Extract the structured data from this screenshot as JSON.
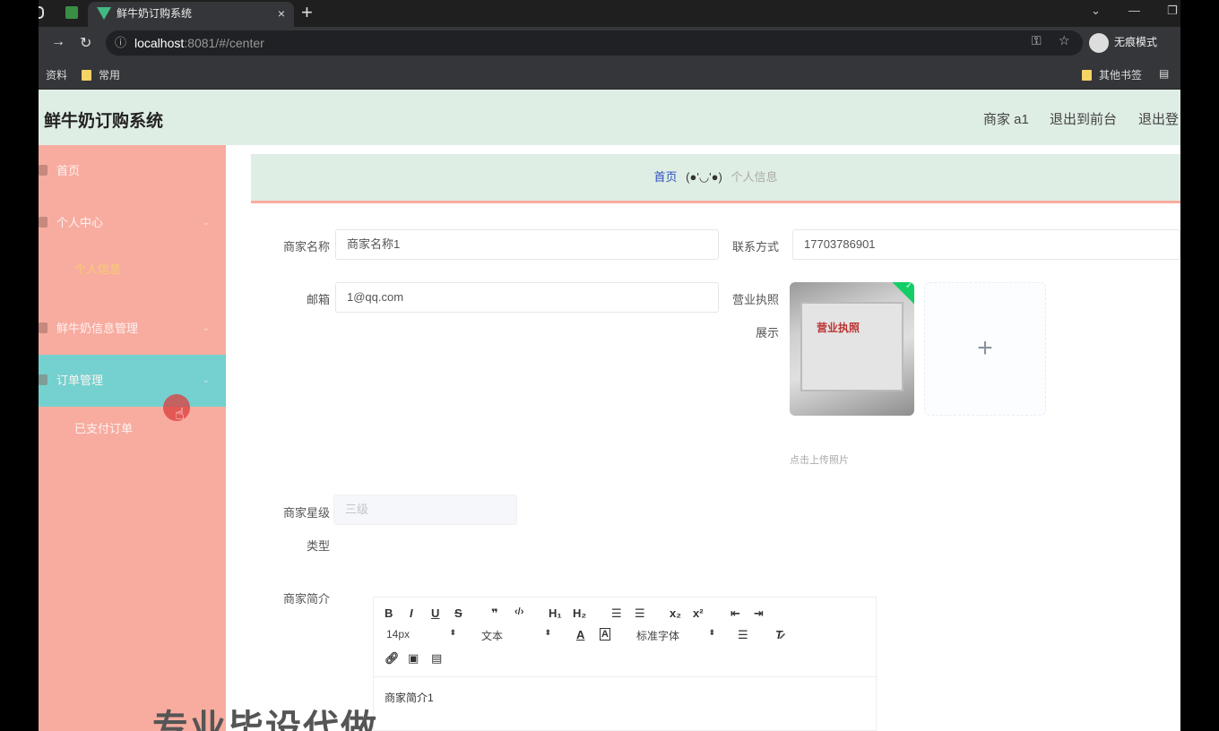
{
  "browser": {
    "tab_title": "鲜牛奶订购系统",
    "tab_close": "×",
    "new_tab": "+",
    "url_host": "localhost",
    "url_rest": ":8081/#/center",
    "incognito_label": "无痕模式",
    "bookmarks": [
      "资料",
      "常用"
    ],
    "other_bookmarks": "其他书签"
  },
  "header": {
    "title": "鲜牛奶订购系统",
    "user": "商家 a1",
    "to_front": "退出到前台",
    "logout": "退出登"
  },
  "sidebar": {
    "items": [
      {
        "label": "首页",
        "arrow": ""
      },
      {
        "label": "个人中心",
        "arrow": "⌄"
      },
      {
        "label": "个人信息",
        "arrow": ""
      },
      {
        "label": "鲜牛奶信息管理",
        "arrow": "⌄"
      },
      {
        "label": "订单管理",
        "arrow": "⌄"
      },
      {
        "label": "已支付订单",
        "arrow": ""
      }
    ]
  },
  "breadcrumb": {
    "home": "首页",
    "face": "(●'◡'●)",
    "current": "个人信息"
  },
  "form": {
    "name_label": "商家名称",
    "name_value": "商家名称1",
    "contact_label": "联系方式",
    "contact_value": "17703786901",
    "email_label": "邮箱",
    "email_value": "1@qq.com",
    "license_label_1": "营业执照",
    "license_label_2": "展示",
    "license_doc_title": "营业执照",
    "upload_plus": "+",
    "upload_tip": "点击上传照片",
    "level_label_1": "商家星级",
    "level_label_2": "类型",
    "level_value": "三级",
    "intro_label": "商家简介"
  },
  "editor": {
    "font_size": "14px",
    "paragraph": "文本",
    "font_family": "标准字体",
    "content": "商家简介1"
  },
  "watermark": "专业毕设代做"
}
